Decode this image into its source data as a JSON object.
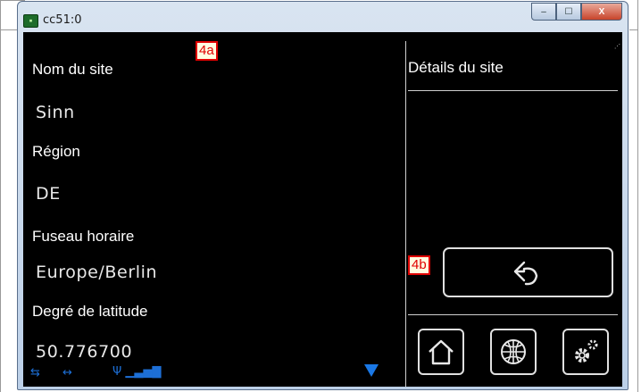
{
  "window": {
    "title": "cc51:0",
    "app_icon_text": "▪"
  },
  "caption": {
    "minimize": "–",
    "maximize": "☐",
    "close": "X"
  },
  "left_panel": {
    "fields": [
      {
        "label": "Nom du site",
        "value": "Sinn"
      },
      {
        "label": "Région",
        "value": "DE"
      },
      {
        "label": "Fuseau horaire",
        "value": "Europe/Berlin"
      },
      {
        "label": "Degré de latitude",
        "value": "50.776700"
      }
    ]
  },
  "right_panel": {
    "title": "Détails du site"
  },
  "markers": {
    "a": "4a",
    "b": "4b"
  },
  "status": {
    "usb": "⇆",
    "net": "↔",
    "signal": "Ψ ▁▃▅▇"
  },
  "colors": {
    "screen_bg": "#000000",
    "status_blue": "#1d6fd6",
    "marker_red": "#e00000"
  },
  "icons": [
    "back-icon",
    "home-icon",
    "globe-icon",
    "settings-icon",
    "scroll-down-icon"
  ]
}
